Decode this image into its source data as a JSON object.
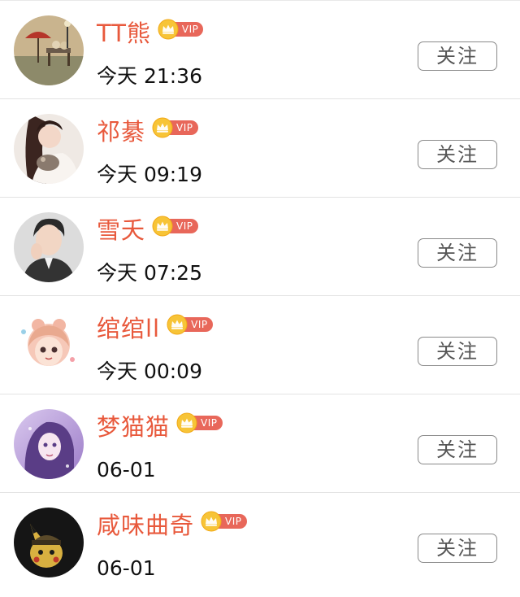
{
  "theme": {
    "name_color": "#e8593c",
    "vip_color": "#e8675a",
    "crown_color": "#f5b820"
  },
  "users": [
    {
      "name": "TT熊",
      "time": "今天 21:36",
      "vip": "VIP",
      "follow": "关注",
      "avatar_icon": "umbrella-painting-avatar-icon"
    },
    {
      "name": "祁綦",
      "time": "今天 09:19",
      "vip": "VIP",
      "follow": "关注",
      "avatar_icon": "girl-with-cat-avatar-icon"
    },
    {
      "name": "雪夭",
      "time": "今天 07:25",
      "vip": "VIP",
      "follow": "关注",
      "avatar_icon": "young-man-avatar-icon"
    },
    {
      "name": "绾绾ll",
      "time": "今天 00:09",
      "vip": "VIP",
      "follow": "关注",
      "avatar_icon": "cartoon-girl-avatar-icon"
    },
    {
      "name": "梦猫猫",
      "time": "06-01",
      "vip": "VIP",
      "follow": "关注",
      "avatar_icon": "purple-anime-girl-avatar-icon"
    },
    {
      "name": "咸味曲奇",
      "time": "06-01",
      "vip": "VIP",
      "follow": "关注",
      "avatar_icon": "pikachu-avatar-icon"
    }
  ]
}
